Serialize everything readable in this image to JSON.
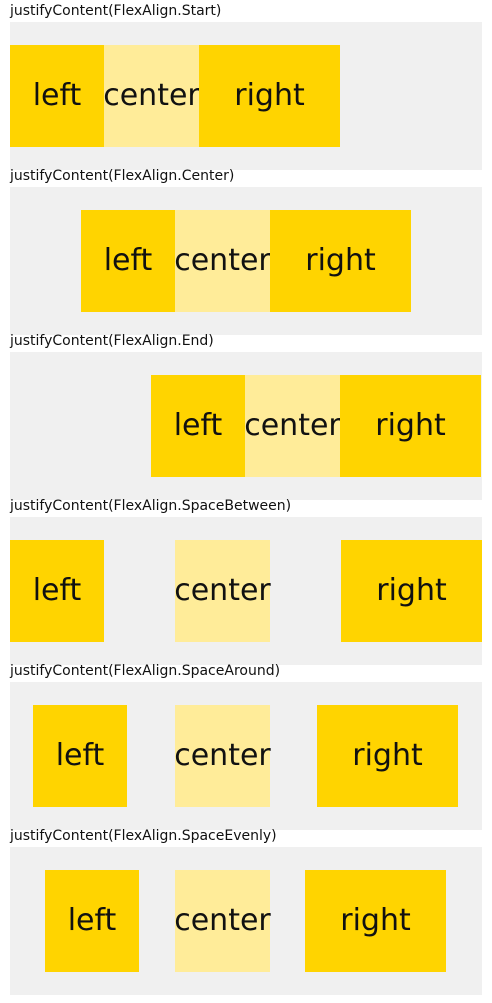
{
  "colors": {
    "panel_background": "#f0f0f0",
    "primary_item": "#ffd400",
    "secondary_item": "#ffec99",
    "text": "#111111"
  },
  "sections": [
    {
      "caption": "justifyContent(FlexAlign.Start)",
      "items": [
        "left",
        "center",
        "right"
      ]
    },
    {
      "caption": "justifyContent(FlexAlign.Center)",
      "items": [
        "left",
        "center",
        "right"
      ]
    },
    {
      "caption": "justifyContent(FlexAlign.End)",
      "items": [
        "left",
        "center",
        "right"
      ]
    },
    {
      "caption": "justifyContent(FlexAlign.SpaceBetween)",
      "items": [
        "left",
        "center",
        "right"
      ]
    },
    {
      "caption": "justifyContent(FlexAlign.SpaceAround)",
      "items": [
        "left",
        "center",
        "right"
      ]
    },
    {
      "caption": "justifyContent(FlexAlign.SpaceEvenly)",
      "items": [
        "left",
        "center",
        "right"
      ]
    }
  ]
}
